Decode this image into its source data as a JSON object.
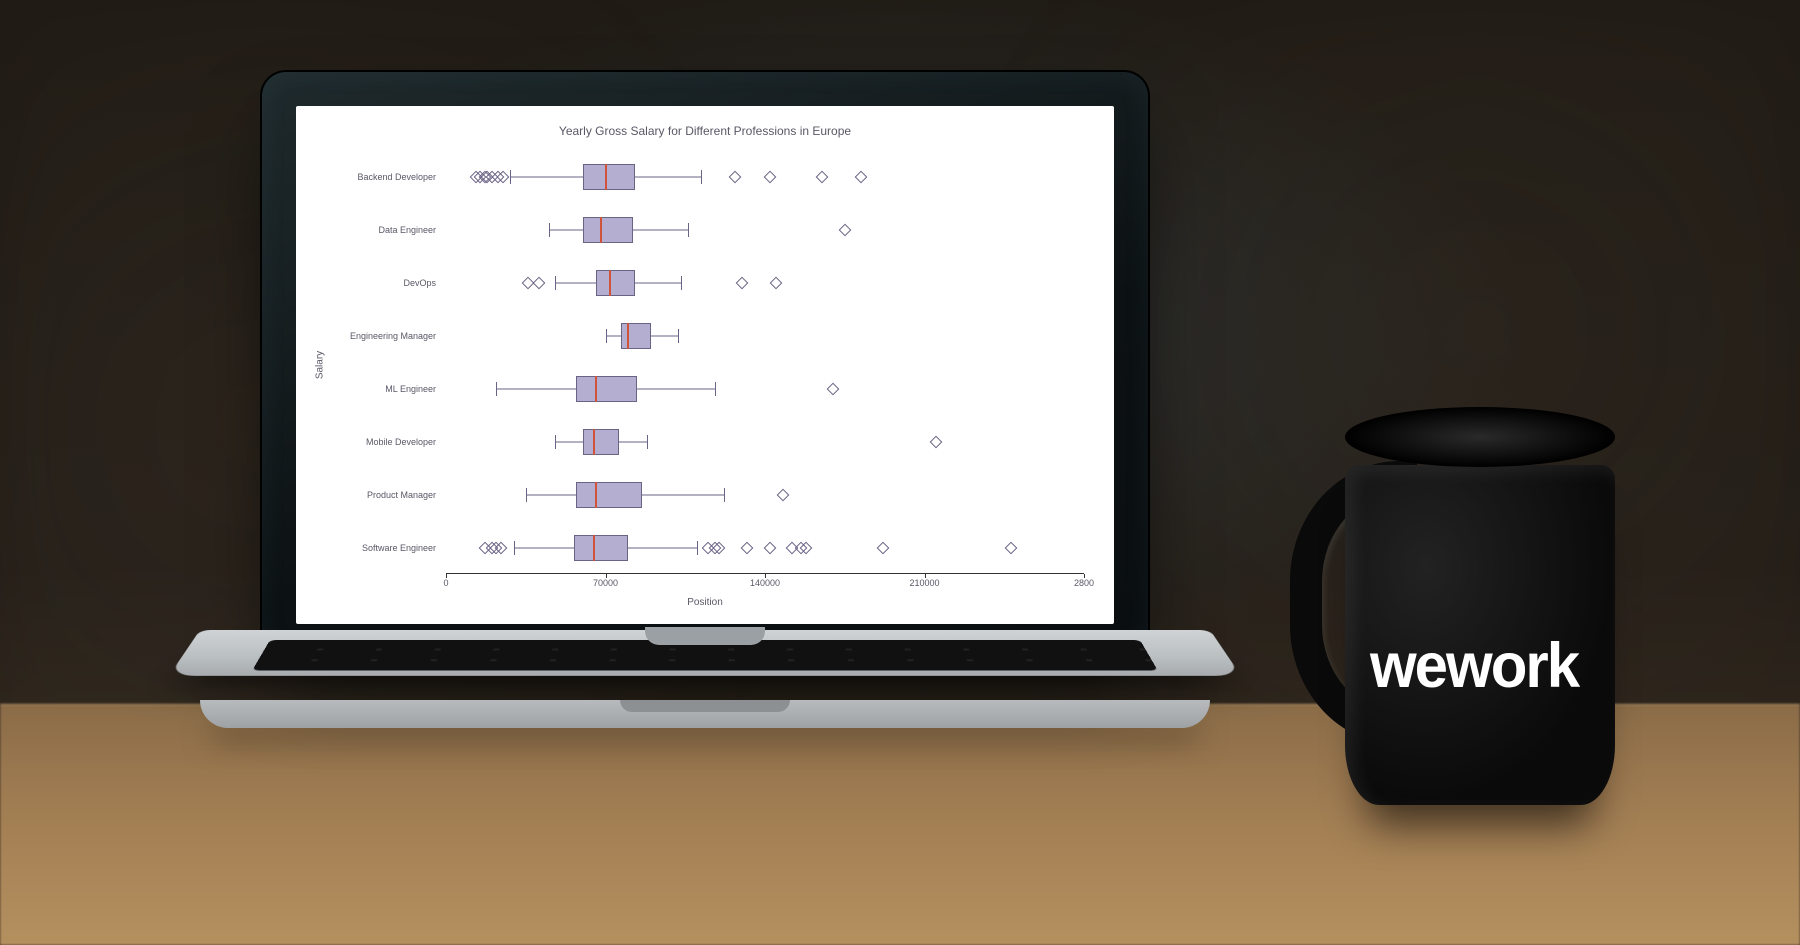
{
  "mug_text": "wework",
  "chart_data": {
    "type": "boxplot",
    "title": "Yearly Gross Salary for Different Professions in Europe",
    "xlabel": "Position",
    "ylabel": "Salary",
    "xlim": [
      0,
      280000
    ],
    "xticks": [
      0,
      70000,
      140000,
      210000,
      280000
    ],
    "xtick_labels": [
      "0",
      "70000",
      "140000",
      "210000",
      "2800"
    ],
    "categories": [
      {
        "name": "Backend Developer",
        "whisker_low": 28000,
        "q1": 60000,
        "median": 70000,
        "q3": 83000,
        "whisker_high": 112000,
        "outliers": [
          13000,
          15000,
          17000,
          18000,
          20000,
          23000,
          25000,
          127000,
          142000,
          165000,
          182000
        ]
      },
      {
        "name": "Data Engineer",
        "whisker_low": 45000,
        "q1": 60000,
        "median": 68000,
        "q3": 82000,
        "whisker_high": 106000,
        "outliers": [
          175000
        ]
      },
      {
        "name": "DevOps",
        "whisker_low": 48000,
        "q1": 66000,
        "median": 72000,
        "q3": 83000,
        "whisker_high": 103000,
        "outliers": [
          36000,
          41000,
          130000,
          145000
        ]
      },
      {
        "name": "Engineering Manager",
        "whisker_low": 70000,
        "q1": 77000,
        "median": 80000,
        "q3": 90000,
        "whisker_high": 102000,
        "outliers": []
      },
      {
        "name": "ML Engineer",
        "whisker_low": 22000,
        "q1": 57000,
        "median": 66000,
        "q3": 84000,
        "whisker_high": 118000,
        "outliers": [
          170000
        ]
      },
      {
        "name": "Mobile Developer",
        "whisker_low": 48000,
        "q1": 60000,
        "median": 65000,
        "q3": 76000,
        "whisker_high": 88000,
        "outliers": [
          215000
        ]
      },
      {
        "name": "Product Manager",
        "whisker_low": 35000,
        "q1": 57000,
        "median": 66000,
        "q3": 86000,
        "whisker_high": 122000,
        "outliers": [
          148000
        ]
      },
      {
        "name": "Software Engineer",
        "whisker_low": 30000,
        "q1": 56000,
        "median": 65000,
        "q3": 80000,
        "whisker_high": 110000,
        "outliers": [
          17000,
          20000,
          22000,
          24000,
          115000,
          118000,
          120000,
          132000,
          142000,
          152000,
          156000,
          158000,
          192000,
          248000
        ]
      }
    ]
  }
}
